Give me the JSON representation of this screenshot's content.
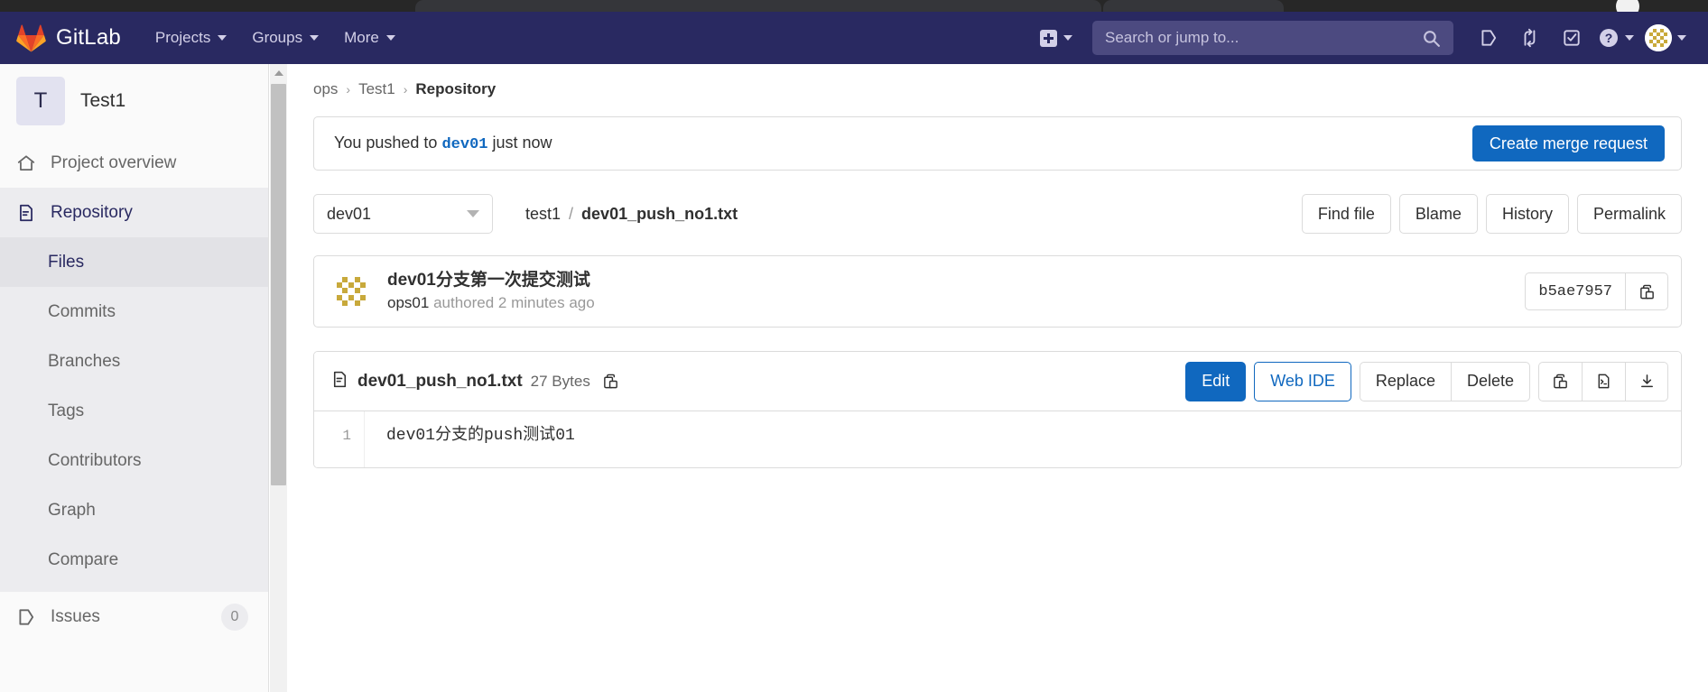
{
  "navbar": {
    "brand": "GitLab",
    "brand_icon": "gitlab-tanuki-logo",
    "links": [
      {
        "label": "Projects",
        "icon": "chevron-down-icon"
      },
      {
        "label": "Groups",
        "icon": "chevron-down-icon"
      },
      {
        "label": "More",
        "icon": "chevron-down-icon"
      }
    ],
    "new_icon": "plus-square-icon",
    "new_caret": "chevron-down-icon",
    "search": {
      "placeholder": "Search or jump to...",
      "value": "",
      "icon": "search-icon"
    },
    "icons": [
      {
        "name": "issues-icon"
      },
      {
        "name": "merge-requests-icon"
      },
      {
        "name": "todos-icon"
      },
      {
        "name": "help-icon"
      },
      {
        "name": "user-avatar"
      }
    ]
  },
  "sidebar": {
    "project": {
      "initial": "T",
      "name": "Test1"
    },
    "items": [
      {
        "label": "Project overview",
        "icon": "home-icon",
        "active": false
      },
      {
        "label": "Repository",
        "icon": "document-icon",
        "active": true
      }
    ],
    "subitems": [
      {
        "label": "Files",
        "active": true
      },
      {
        "label": "Commits",
        "active": false
      },
      {
        "label": "Branches",
        "active": false
      },
      {
        "label": "Tags",
        "active": false
      },
      {
        "label": "Contributors",
        "active": false
      },
      {
        "label": "Graph",
        "active": false
      },
      {
        "label": "Compare",
        "active": false
      }
    ],
    "issues": {
      "label": "Issues",
      "icon": "issues-icon",
      "badge": "0"
    }
  },
  "breadcrumb": {
    "group": "ops",
    "project": "Test1",
    "section": "Repository",
    "separator": "›"
  },
  "push_alert": {
    "prefix": "You pushed to",
    "branch": "dev01",
    "suffix": "just now",
    "button": "Create merge request"
  },
  "file_toolbar": {
    "branch": "dev01",
    "path_root": "test1",
    "path_sep": "/",
    "path_file": "dev01_push_no1.txt",
    "buttons": [
      "Find file",
      "Blame",
      "History",
      "Permalink"
    ]
  },
  "commit": {
    "title": "dev01分支第一次提交测试",
    "author": "ops01",
    "meta": "authored 2 minutes ago",
    "sha": "b5ae7957",
    "copy_icon": "copy-icon",
    "avatar_icon": "identicon-avatar"
  },
  "file": {
    "icon": "file-text-icon",
    "name": "dev01_push_no1.txt",
    "size": "27 Bytes",
    "copy_path_icon": "copy-icon",
    "actions": {
      "edit": "Edit",
      "web_ide": "Web IDE",
      "replace": "Replace",
      "delete": "Delete"
    },
    "icon_buttons": [
      {
        "name": "copy-contents-icon"
      },
      {
        "name": "open-raw-icon"
      },
      {
        "name": "download-icon"
      }
    ],
    "lines": [
      {
        "number": "1",
        "text": "dev01分支的push测试01"
      }
    ]
  },
  "colors": {
    "navbar_bg": "#292961",
    "accent_blue": "#1068bf",
    "sidebar_bg": "#fafafa",
    "active_bg": "#ececef"
  }
}
